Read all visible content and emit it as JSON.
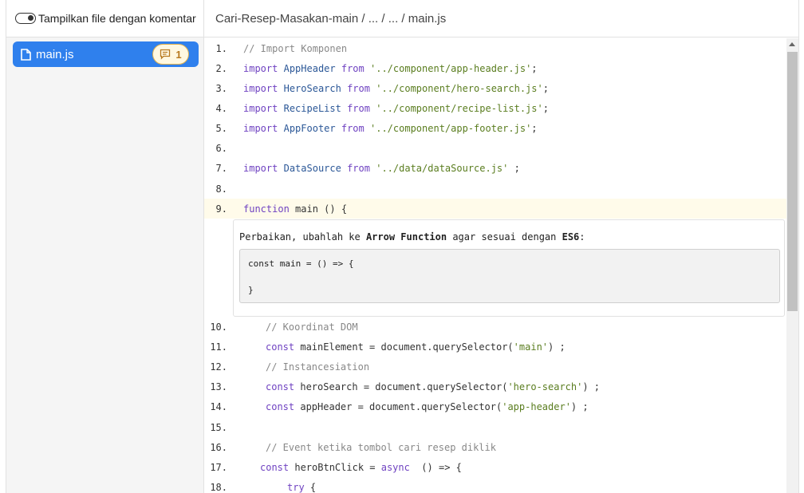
{
  "sidebar": {
    "toggle_label": "Tampilkan file dengan komentar",
    "file": {
      "name": "main.js",
      "comment_count": "1",
      "icon": "file-icon"
    }
  },
  "breadcrumb": {
    "path": "Cari-Resep-Masakan-main / ... / ... / main.js"
  },
  "code_lines": [
    {
      "num": "1.",
      "text": "// Import Komponen"
    },
    {
      "num": "2.",
      "text": "import AppHeader from '../component/app-header.js';"
    },
    {
      "num": "3.",
      "text": "import HeroSearch from '../component/hero-search.js';"
    },
    {
      "num": "4.",
      "text": "import RecipeList from '../component/recipe-list.js';"
    },
    {
      "num": "5.",
      "text": "import AppFooter from '../component/app-footer.js';"
    },
    {
      "num": "6.",
      "text": ""
    },
    {
      "num": "7.",
      "text": "import DataSource from '../data/dataSource.js' ;"
    },
    {
      "num": "8.",
      "text": ""
    },
    {
      "num": "9.",
      "text": "function main () {"
    },
    {
      "num": "10.",
      "text": "// Koordinat DOM"
    },
    {
      "num": "11.",
      "text": "const mainElement = document.querySelector('main') ;"
    },
    {
      "num": "12.",
      "text": "// Instancesiation"
    },
    {
      "num": "13.",
      "text": "const heroSearch = document.querySelector('hero-search') ;"
    },
    {
      "num": "14.",
      "text": "const appHeader = document.querySelector('app-header') ;"
    },
    {
      "num": "15.",
      "text": ""
    },
    {
      "num": "16.",
      "text": "// Event ketika tombol cari resep diklik"
    },
    {
      "num": "17.",
      "text": "const heroBtnClick = async  () => {"
    },
    {
      "num": "18.",
      "text": "try {"
    }
  ],
  "review_comment": {
    "text_prefix": "Perbaikan, ubahlah ke ",
    "bold_1": "Arrow Function",
    "text_middle": " agar sesuai dengan ",
    "bold_2": "ES6",
    "text_suffix": ":",
    "suggestion_lines": [
      "const main = () => {",
      "}"
    ]
  },
  "colors": {
    "active_file_bg": "#2f80ed",
    "badge_bg": "#fff8e1",
    "badge_text": "#b7791f",
    "highlight_line_bg": "#fffbea"
  }
}
